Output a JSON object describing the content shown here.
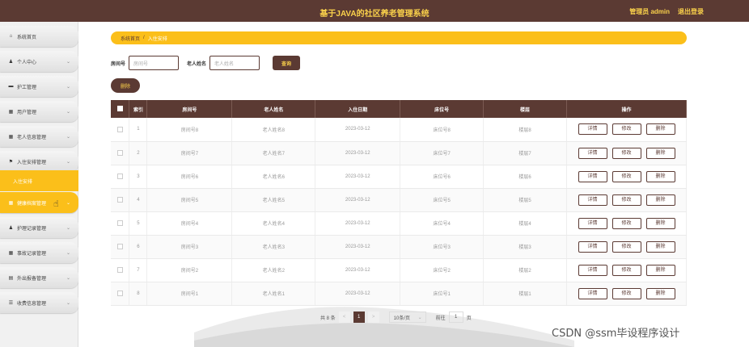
{
  "header": {
    "title": "基于JAVA的社区养老管理系统",
    "user": "管理员 admin",
    "logout": "退出登录"
  },
  "sidebar": {
    "items": [
      {
        "label": "系统首页",
        "icon": "home-icon",
        "glyph": "⌂"
      },
      {
        "label": "个人中心",
        "icon": "person-icon",
        "glyph": "♟"
      },
      {
        "label": "护工管理",
        "icon": "folder-icon",
        "glyph": "▬"
      },
      {
        "label": "用户管理",
        "icon": "grid-icon",
        "glyph": "▦"
      },
      {
        "label": "老人信息管理",
        "icon": "grid-icon",
        "glyph": "▦"
      },
      {
        "label": "入住安排管理",
        "icon": "flag-icon",
        "glyph": "⚑"
      },
      {
        "label": "健康档案管理",
        "icon": "grid-icon",
        "glyph": "▦"
      },
      {
        "label": "护理记录管理",
        "icon": "person-icon",
        "glyph": "♟"
      },
      {
        "label": "事故记录管理",
        "icon": "grid-icon",
        "glyph": "▦"
      },
      {
        "label": "外出报备管理",
        "icon": "card-icon",
        "glyph": "▤"
      },
      {
        "label": "收费信息管理",
        "icon": "sliders-icon",
        "glyph": "☰"
      }
    ],
    "submenu_label": "入住安排"
  },
  "breadcrumb": {
    "home": "系统首页",
    "current": "入住安排"
  },
  "search": {
    "room_label": "房间号",
    "room_placeholder": "房间号",
    "name_label": "老人姓名",
    "name_placeholder": "老人姓名",
    "button": "查询"
  },
  "delete_button": "删除",
  "table": {
    "headers": [
      "索引",
      "房间号",
      "老人姓名",
      "入住日期",
      "床位号",
      "楼层",
      "操作"
    ],
    "actions": {
      "detail": "详情",
      "edit": "修改",
      "delete": "删除"
    },
    "rows": [
      {
        "index": "1",
        "room": "房间号8",
        "name": "老人姓名8",
        "date": "2023-03-12",
        "bed": "床位号8",
        "floor": "楼层8"
      },
      {
        "index": "2",
        "room": "房间号7",
        "name": "老人姓名7",
        "date": "2023-03-12",
        "bed": "床位号7",
        "floor": "楼层7"
      },
      {
        "index": "3",
        "room": "房间号6",
        "name": "老人姓名6",
        "date": "2023-03-12",
        "bed": "床位号6",
        "floor": "楼层6"
      },
      {
        "index": "4",
        "room": "房间号5",
        "name": "老人姓名5",
        "date": "2023-03-12",
        "bed": "床位号5",
        "floor": "楼层5"
      },
      {
        "index": "5",
        "room": "房间号4",
        "name": "老人姓名4",
        "date": "2023-03-12",
        "bed": "床位号4",
        "floor": "楼层4"
      },
      {
        "index": "6",
        "room": "房间号3",
        "name": "老人姓名3",
        "date": "2023-03-12",
        "bed": "床位号3",
        "floor": "楼层3"
      },
      {
        "index": "7",
        "room": "房间号2",
        "name": "老人姓名2",
        "date": "2023-03-12",
        "bed": "床位号2",
        "floor": "楼层2"
      },
      {
        "index": "8",
        "room": "房间号1",
        "name": "老人姓名1",
        "date": "2023-03-12",
        "bed": "床位号1",
        "floor": "楼层1"
      }
    ]
  },
  "pagination": {
    "total": "共 8 条",
    "prev": "<",
    "current": "1",
    "next": ">",
    "page_size": "10条/页",
    "goto_label": "前往",
    "goto_value": "1",
    "page_unit": "页"
  },
  "watermark": "CSDN @ssm毕设程序设计",
  "colors": {
    "primary": "#5b3a33",
    "accent": "#fbbf1a"
  }
}
